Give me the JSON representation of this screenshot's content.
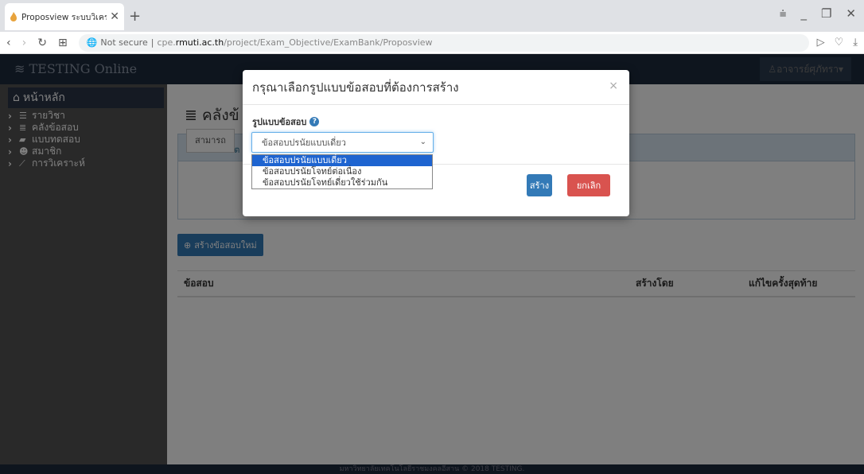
{
  "browser": {
    "tab_title": "Proposview ระบบวิเคราะห์แ",
    "new_tab": "+",
    "url_security": "Not secure",
    "url_prefix": "cpe.",
    "url_host": "rmuti.ac.th",
    "url_path": "/project/Exam_Objective/ExamBank/Proposview"
  },
  "navbar": {
    "brand": "TESTING Online",
    "user": "อาจารย์ศุภัทรา"
  },
  "sidebar": {
    "home": "หน้าหลัก",
    "items": [
      {
        "label": "รายวิชา",
        "icon": "list-icon"
      },
      {
        "label": "คลังข้อสอบ",
        "icon": "database-icon"
      },
      {
        "label": "แบบทดสอบ",
        "icon": "book-icon"
      },
      {
        "label": "สมาชิก",
        "icon": "users-icon"
      },
      {
        "label": "การวิเคราะห์",
        "icon": "chart-icon"
      }
    ]
  },
  "main": {
    "title": "คลังข้",
    "panel_head": "เลือกข้อสอบต",
    "panel_button": "สามารถ",
    "create_button": "สร้างข้อสอบใหม่",
    "table_headers": [
      "ข้อสอบ",
      "สร้างโดย",
      "แก้ไขครั้งสุดท้าย"
    ]
  },
  "modal": {
    "title": "กรุณาเลือกรูปแบบข้อสอบที่ต้องการสร้าง",
    "close": "×",
    "field_label": "รูปแบบข้อสอบ",
    "select_value": "ข้อสอบปรนัยแบบเดี่ยว",
    "options": [
      "ข้อสอบปรนัยแบบเดี่ยว",
      "ข้อสอบปรนัยโจทย์ต่อเนื่อง",
      "ข้อสอบปรนัยโจทย์เดี่ยวใช้ร่วมกัน"
    ],
    "create_label": "สร้าง",
    "cancel_label": "ยกเลิก"
  },
  "footer": {
    "text": "มหาวิทยาลัยเทคโนโลยีราชมงคลอีสาน © 2018 TESTING."
  }
}
